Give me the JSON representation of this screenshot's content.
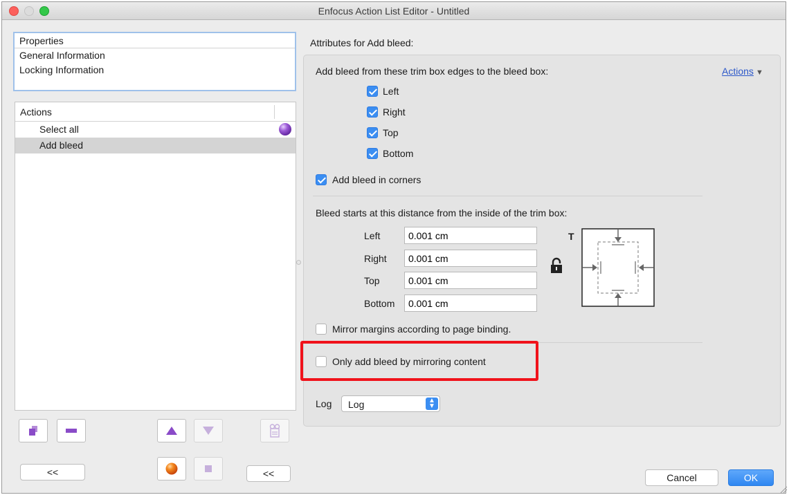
{
  "window": {
    "title": "Enfocus Action List Editor - Untitled"
  },
  "properties": {
    "header": "Properties",
    "items": [
      "General Information",
      "Locking Information"
    ]
  },
  "actions": {
    "header": "Actions",
    "items": [
      {
        "label": "Select all",
        "selected": false,
        "icon": "purple-ball-icon"
      },
      {
        "label": "Add bleed",
        "selected": true
      }
    ]
  },
  "left_buttons": {
    "collapse_left": "<<",
    "collapse_right": "<<"
  },
  "attributes": {
    "title": "Attributes for Add bleed:",
    "edges_label": "Add bleed from these trim box edges to the bleed box:",
    "actions_menu": "Actions",
    "edges": [
      {
        "label": "Left",
        "checked": true
      },
      {
        "label": "Right",
        "checked": true
      },
      {
        "label": "Top",
        "checked": true
      },
      {
        "label": "Bottom",
        "checked": true
      }
    ],
    "corners": {
      "label": "Add bleed in corners",
      "checked": true
    },
    "distance_label": "Bleed starts at this distance from the inside of the trim box:",
    "distances": [
      {
        "label": "Left",
        "value": "0.001 cm"
      },
      {
        "label": "Right",
        "value": "0.001 cm"
      },
      {
        "label": "Top",
        "value": "0.001 cm"
      },
      {
        "label": "Bottom",
        "value": "0.001 cm"
      }
    ],
    "diagram_label": "T",
    "mirror": {
      "label": "Mirror margins according to page binding.",
      "checked": false
    },
    "only_mirror": {
      "label": "Only add bleed by mirroring content",
      "checked": false
    },
    "log": {
      "label": "Log",
      "value": "Log"
    }
  },
  "footer": {
    "cancel": "Cancel",
    "ok": "OK"
  },
  "colors": {
    "accent": "#3b8ef2",
    "highlight": "#f0121b",
    "purple": "#8a4bc8"
  }
}
